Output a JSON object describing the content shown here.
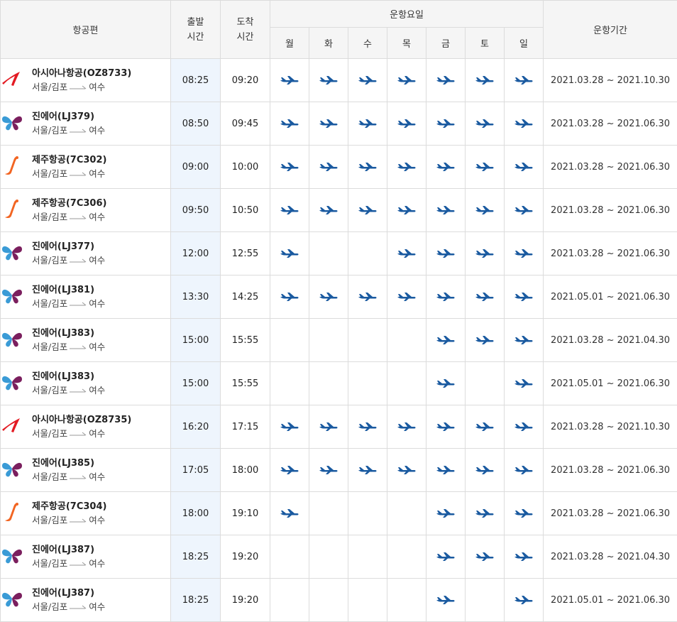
{
  "colors": {
    "header_bg": "#f5f5f5",
    "departure_bg": "#eef5fd",
    "plane_icon": "#1a5aa0",
    "asiana": "#e31b23",
    "jinair_left": "#3a9bd6",
    "jinair_right": "#7b1f5e",
    "jeju": "#f26522"
  },
  "header": {
    "flight": "항공편",
    "departure": "출발\n시간",
    "arrival": "도착\n시간",
    "days_group": "운항요일",
    "period": "운항기간",
    "days": [
      "월",
      "화",
      "수",
      "목",
      "금",
      "토",
      "일"
    ]
  },
  "flights": [
    {
      "airline": "asiana",
      "logo_icon": "asiana-logo-icon",
      "name": "아시아나항공(OZ8733)",
      "from": "서울/김포",
      "to": "여수",
      "dep": "08:25",
      "arr": "09:20",
      "days": [
        1,
        1,
        1,
        1,
        1,
        1,
        1
      ],
      "period": "2021.03.28 ~ 2021.10.30"
    },
    {
      "airline": "jinair",
      "logo_icon": "jinair-logo-icon",
      "name": "진에어(LJ379)",
      "from": "서울/김포",
      "to": "여수",
      "dep": "08:50",
      "arr": "09:45",
      "days": [
        1,
        1,
        1,
        1,
        1,
        1,
        1
      ],
      "period": "2021.03.28 ~ 2021.06.30"
    },
    {
      "airline": "jeju",
      "logo_icon": "jejuair-logo-icon",
      "name": "제주항공(7C302)",
      "from": "서울/김포",
      "to": "여수",
      "dep": "09:00",
      "arr": "10:00",
      "days": [
        1,
        1,
        1,
        1,
        1,
        1,
        1
      ],
      "period": "2021.03.28 ~ 2021.06.30"
    },
    {
      "airline": "jeju",
      "logo_icon": "jejuair-logo-icon",
      "name": "제주항공(7C306)",
      "from": "서울/김포",
      "to": "여수",
      "dep": "09:50",
      "arr": "10:50",
      "days": [
        1,
        1,
        1,
        1,
        1,
        1,
        1
      ],
      "period": "2021.03.28 ~ 2021.06.30"
    },
    {
      "airline": "jinair",
      "logo_icon": "jinair-logo-icon",
      "name": "진에어(LJ377)",
      "from": "서울/김포",
      "to": "여수",
      "dep": "12:00",
      "arr": "12:55",
      "days": [
        1,
        0,
        0,
        1,
        1,
        1,
        1
      ],
      "period": "2021.03.28 ~ 2021.06.30"
    },
    {
      "airline": "jinair",
      "logo_icon": "jinair-logo-icon",
      "name": "진에어(LJ381)",
      "from": "서울/김포",
      "to": "여수",
      "dep": "13:30",
      "arr": "14:25",
      "days": [
        1,
        1,
        1,
        1,
        1,
        1,
        1
      ],
      "period": "2021.05.01 ~ 2021.06.30"
    },
    {
      "airline": "jinair",
      "logo_icon": "jinair-logo-icon",
      "name": "진에어(LJ383)",
      "from": "서울/김포",
      "to": "여수",
      "dep": "15:00",
      "arr": "15:55",
      "days": [
        0,
        0,
        0,
        0,
        1,
        1,
        1
      ],
      "period": "2021.03.28 ~ 2021.04.30"
    },
    {
      "airline": "jinair",
      "logo_icon": "jinair-logo-icon",
      "name": "진에어(LJ383)",
      "from": "서울/김포",
      "to": "여수",
      "dep": "15:00",
      "arr": "15:55",
      "days": [
        0,
        0,
        0,
        0,
        1,
        0,
        1
      ],
      "period": "2021.05.01 ~ 2021.06.30"
    },
    {
      "airline": "asiana",
      "logo_icon": "asiana-logo-icon",
      "name": "아시아나항공(OZ8735)",
      "from": "서울/김포",
      "to": "여수",
      "dep": "16:20",
      "arr": "17:15",
      "days": [
        1,
        1,
        1,
        1,
        1,
        1,
        1
      ],
      "period": "2021.03.28 ~ 2021.10.30"
    },
    {
      "airline": "jinair",
      "logo_icon": "jinair-logo-icon",
      "name": "진에어(LJ385)",
      "from": "서울/김포",
      "to": "여수",
      "dep": "17:05",
      "arr": "18:00",
      "days": [
        1,
        1,
        1,
        1,
        1,
        1,
        1
      ],
      "period": "2021.03.28 ~ 2021.06.30"
    },
    {
      "airline": "jeju",
      "logo_icon": "jejuair-logo-icon",
      "name": "제주항공(7C304)",
      "from": "서울/김포",
      "to": "여수",
      "dep": "18:00",
      "arr": "19:10",
      "days": [
        1,
        0,
        0,
        0,
        1,
        1,
        1
      ],
      "period": "2021.03.28 ~ 2021.06.30"
    },
    {
      "airline": "jinair",
      "logo_icon": "jinair-logo-icon",
      "name": "진에어(LJ387)",
      "from": "서울/김포",
      "to": "여수",
      "dep": "18:25",
      "arr": "19:20",
      "days": [
        0,
        0,
        0,
        0,
        1,
        1,
        1
      ],
      "period": "2021.03.28 ~ 2021.04.30"
    },
    {
      "airline": "jinair",
      "logo_icon": "jinair-logo-icon",
      "name": "진에어(LJ387)",
      "from": "서울/김포",
      "to": "여수",
      "dep": "18:25",
      "arr": "19:20",
      "days": [
        0,
        0,
        0,
        0,
        1,
        0,
        1
      ],
      "period": "2021.05.01 ~ 2021.06.30"
    }
  ]
}
